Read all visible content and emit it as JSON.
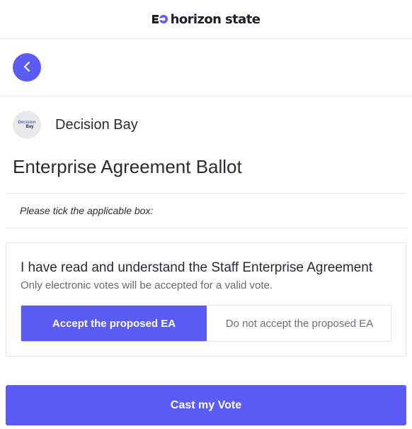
{
  "header": {
    "logo_text": "horizon state",
    "logo_icon": "horizon-state-mark-icon"
  },
  "nav": {
    "back_icon": "chevron-left-icon"
  },
  "organization": {
    "name": "Decision Bay",
    "avatar_line1": "Decision",
    "avatar_line2": "Bay"
  },
  "ballot": {
    "title": "Enterprise Agreement Ballot",
    "instruction": "Please tick the applicable box:",
    "question": {
      "title": "I have read and understand the Staff Enterprise Agreement",
      "subtitle": "Only electronic votes will be accepted for a valid vote.",
      "options": [
        {
          "label": "Accept the proposed EA",
          "selected": true
        },
        {
          "label": "Do not accept the proposed EA",
          "selected": false
        }
      ]
    }
  },
  "actions": {
    "cast_label": "Cast my Vote"
  },
  "colors": {
    "accent": "#5b5bf6",
    "text": "#2b2b33",
    "muted": "#666a73",
    "border": "#e6e6e6"
  }
}
